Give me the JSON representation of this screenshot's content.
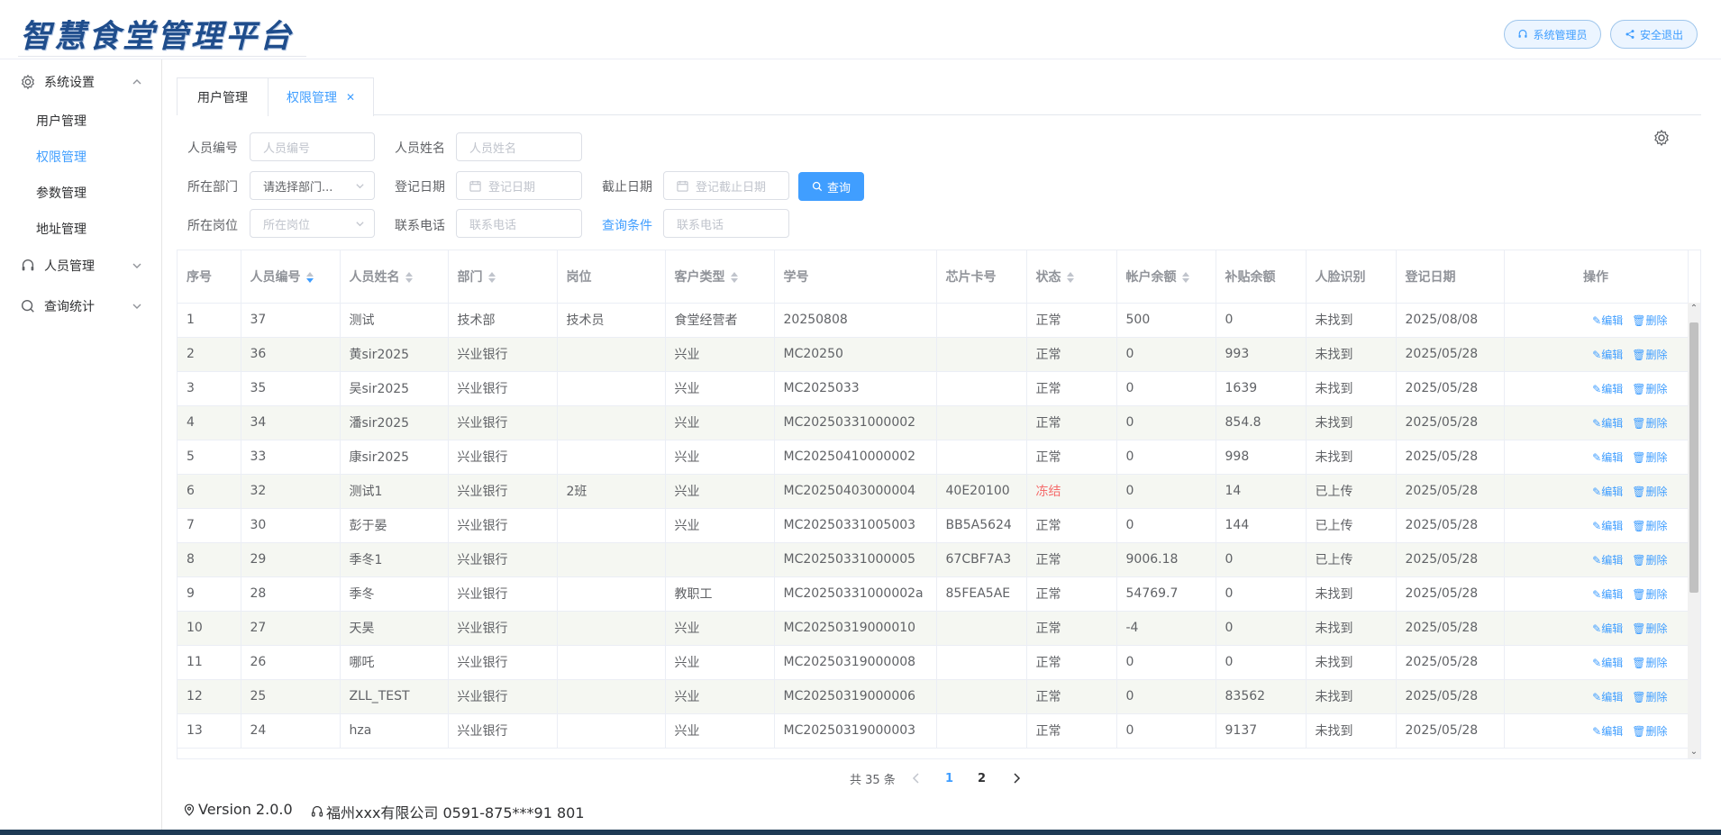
{
  "header": {
    "logo_text": "智慧食堂管理平台",
    "admin_label": "系统管理员",
    "logout_label": "安全退出"
  },
  "sidebar": {
    "groups": [
      {
        "label": "系统设置",
        "icon": "gear-icon",
        "expanded": true
      },
      {
        "label": "人员管理",
        "icon": "headset-icon",
        "expanded": false
      },
      {
        "label": "查询统计",
        "icon": "search-icon",
        "expanded": false
      }
    ],
    "sub_items": [
      "用户管理",
      "权限管理",
      "参数管理",
      "地址管理"
    ],
    "active_sub": "权限管理"
  },
  "tabs": [
    {
      "label": "用户管理"
    },
    {
      "label": "权限管理",
      "closable": true
    }
  ],
  "filters": {
    "emp_no_label": "人员编号",
    "emp_no_placeholder": "人员编号",
    "emp_name_label": "人员姓名",
    "emp_name_placeholder": "人员姓名",
    "dept_label": "所在部门",
    "dept_value": "请选择部门...",
    "reg_date_label": "登记日期",
    "reg_date_placeholder": "登记日期",
    "end_date_label": "截止日期",
    "end_date_placeholder": "登记截止日期",
    "search_label": "查询",
    "post_label": "所在岗位",
    "post_placeholder": "所在岗位",
    "phone_label": "联系电话",
    "phone_placeholder": "联系电话",
    "query_cond_label": "查询条件",
    "phone2_placeholder": "联系电话"
  },
  "table": {
    "columns": [
      "序号",
      "人员编号",
      "人员姓名",
      "部门",
      "岗位",
      "客户类型",
      "学号",
      "芯片卡号",
      "状态",
      "帐户余额",
      "补贴余额",
      "人脸识别",
      "登记日期",
      "操作"
    ],
    "edit_label": "编辑",
    "delete_label": "删除",
    "rows": [
      [
        "1",
        "37",
        "测试",
        "技术部",
        "技术员",
        "食堂经营者",
        "20250808",
        "",
        "正常",
        "500",
        "0",
        "未找到",
        "2025/08/08"
      ],
      [
        "2",
        "36",
        "黄sir2025",
        "兴业银行",
        "",
        "兴业",
        "MC20250",
        "",
        "正常",
        "0",
        "993",
        "未找到",
        "2025/05/28"
      ],
      [
        "3",
        "35",
        "吴sir2025",
        "兴业银行",
        "",
        "兴业",
        "MC2025033",
        "",
        "正常",
        "0",
        "1639",
        "未找到",
        "2025/05/28"
      ],
      [
        "4",
        "34",
        "潘sir2025",
        "兴业银行",
        "",
        "兴业",
        "MC20250331000002",
        "",
        "正常",
        "0",
        "854.8",
        "未找到",
        "2025/05/28"
      ],
      [
        "5",
        "33",
        "康sir2025",
        "兴业银行",
        "",
        "兴业",
        "MC20250410000002",
        "",
        "正常",
        "0",
        "998",
        "未找到",
        "2025/05/28"
      ],
      [
        "6",
        "32",
        "测试1",
        "兴业银行",
        "2班",
        "兴业",
        "MC20250403000004",
        "40E20100",
        "冻结",
        "0",
        "14",
        "已上传",
        "2025/05/28"
      ],
      [
        "7",
        "30",
        "彭于晏",
        "兴业银行",
        "",
        "兴业",
        "MC20250331005003",
        "BB5A5624",
        "正常",
        "0",
        "144",
        "已上传",
        "2025/05/28"
      ],
      [
        "8",
        "29",
        "季冬1",
        "兴业银行",
        "",
        "",
        "MC20250331000005",
        "67CBF7A3",
        "正常",
        "9006.18",
        "0",
        "已上传",
        "2025/05/28"
      ],
      [
        "9",
        "28",
        "季冬",
        "兴业银行",
        "",
        "教职工",
        "MC20250331000002a",
        "85FEA5AE",
        "正常",
        "54769.7",
        "0",
        "未找到",
        "2025/05/28"
      ],
      [
        "10",
        "27",
        "天昊",
        "兴业银行",
        "",
        "兴业",
        "MC20250319000010",
        "",
        "正常",
        "-4",
        "0",
        "未找到",
        "2025/05/28"
      ],
      [
        "11",
        "26",
        "哪吒",
        "兴业银行",
        "",
        "兴业",
        "MC20250319000008",
        "",
        "正常",
        "0",
        "0",
        "未找到",
        "2025/05/28"
      ],
      [
        "12",
        "25",
        "ZLL_TEST",
        "兴业银行",
        "",
        "兴业",
        "MC20250319000006",
        "",
        "正常",
        "0",
        "83562",
        "未找到",
        "2025/05/28"
      ],
      [
        "13",
        "24",
        "hza",
        "兴业银行",
        "",
        "兴业",
        "MC20250319000003",
        "",
        "正常",
        "0",
        "9137",
        "未找到",
        "2025/05/28"
      ]
    ],
    "frozen_color": "#f56c6c"
  },
  "pagination": {
    "total_text": "共 35 条",
    "pages": [
      "1",
      "2"
    ],
    "current": "1"
  },
  "footer": {
    "version": "Version 2.0.0",
    "company": "福州xxx有限公司 0591-875***91 801"
  },
  "colors": {
    "accent": "#409eff",
    "logo": "#1f4d8c"
  }
}
